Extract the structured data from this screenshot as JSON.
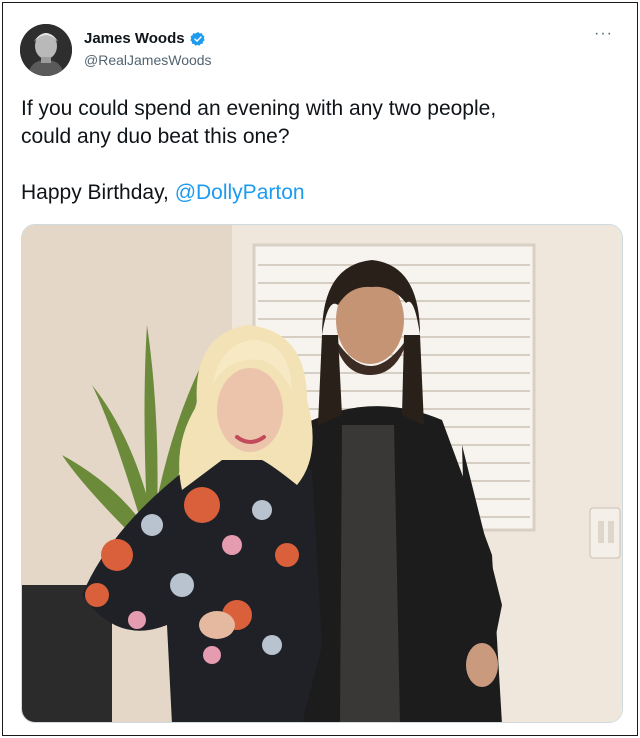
{
  "author": {
    "display_name": "James Woods",
    "handle": "@RealJamesWoods",
    "verified": true,
    "verified_icon": "verified-badge-icon",
    "avatar_icon": "avatar"
  },
  "menu": {
    "more_label": "···",
    "more_icon": "more-options-icon"
  },
  "tweet": {
    "line1": "If you could spend an evening with any two people,",
    "line2": "could any duo beat this one?",
    "birthday_text": "Happy Birthday, ",
    "mention": "@DollyParton"
  },
  "media": {
    "type": "photo"
  },
  "colors": {
    "link": "#1d9bf0",
    "verified": "#1d9bf0",
    "text": "#0f1419",
    "secondary": "#536471"
  }
}
